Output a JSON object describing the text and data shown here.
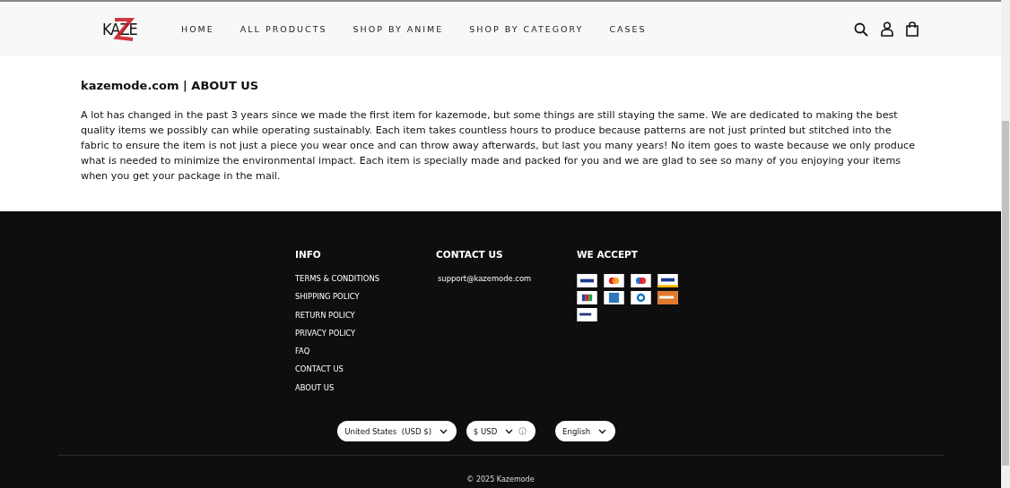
{
  "header": {
    "logo": "KAZE",
    "nav": [
      {
        "label": "HOME"
      },
      {
        "label": "ALL PRODUCTS"
      },
      {
        "label": "SHOP BY ANIME"
      },
      {
        "label": "SHOP BY CATEGORY"
      },
      {
        "label": "CASES"
      }
    ]
  },
  "about": {
    "title": "kazemode.com | ABOUT US",
    "body": "A lot has changed in the past 3 years since we made the first item for kazemode, but some things are still staying the same. We are dedicated to making the best quality items we possibly can while operating sustainably. Each item takes countless hours to produce because patterns are not just printed but stitched into the fabric to ensure the item is not just a piece you wear once and can throw away afterwards, but last you many years! No item goes to waste because we only produce what is needed to minimize the environmental impact. Each item is specially made and packed for you and we are glad to see so many of you enjoying your items when you get your package in the mail."
  },
  "footer": {
    "info": {
      "title": "INFO",
      "links": [
        "TERMS & CONDITIONS",
        "SHIPPING POLICY",
        "RETURN POLICY",
        "PRIVACY POLICY",
        "FAQ",
        "CONTACT US",
        "ABOUT US"
      ]
    },
    "contact": {
      "title": "CONTACT US",
      "email": "support@kazemode.com"
    },
    "accept": {
      "title": "WE ACCEPT",
      "cards": [
        {
          "kind": "visa"
        },
        {
          "kind": "mastercard"
        },
        {
          "kind": "maestro"
        },
        {
          "kind": "visa-gold"
        },
        {
          "kind": "jcb"
        },
        {
          "kind": "amex"
        },
        {
          "kind": "diners"
        },
        {
          "kind": "discover"
        },
        {
          "kind": "paypal"
        }
      ]
    },
    "selectors": [
      {
        "label": "United States  (USD $)",
        "info": false
      },
      {
        "label": "$ USD",
        "info": true
      },
      {
        "label": "English",
        "info": false
      }
    ],
    "copyright": "© 2025 Kazemode"
  }
}
